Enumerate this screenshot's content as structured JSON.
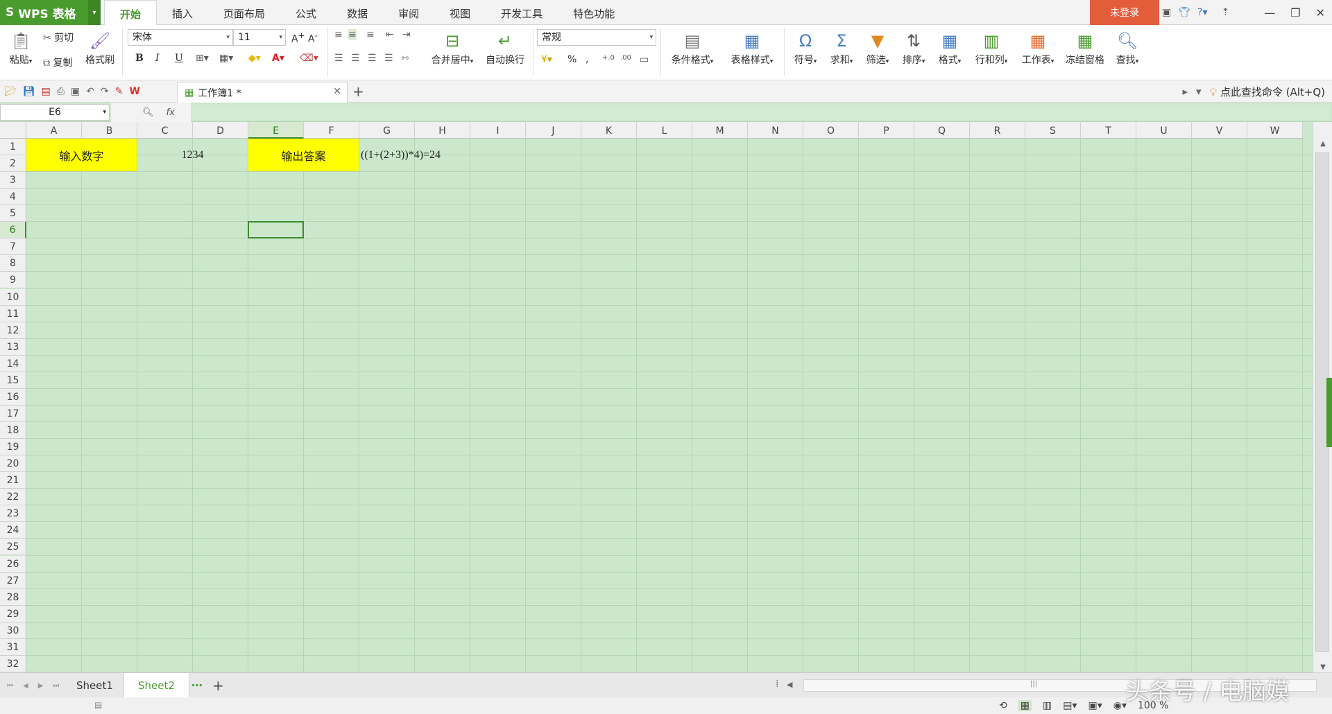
{
  "app": {
    "name": "WPS 表格",
    "logo_icon": "wps-s-icon"
  },
  "menu": {
    "tabs": [
      "开始",
      "插入",
      "页面布局",
      "公式",
      "数据",
      "审阅",
      "视图",
      "开发工具",
      "特色功能"
    ],
    "active": "开始"
  },
  "account": {
    "login_label": "未登录"
  },
  "ribbon": {
    "paste": "粘贴",
    "cut": "剪切",
    "copy": "复制",
    "format_painter": "格式刷",
    "font_name": "宋体",
    "font_size": "11",
    "bold": "B",
    "italic": "I",
    "underline": "U",
    "merge_center": "合并居中",
    "wrap_text": "自动换行",
    "number_format": "常规",
    "percent": "%",
    "comma": ",",
    "conditional_format": "条件格式",
    "table_style": "表格样式",
    "symbol": "符号",
    "sum": "求和",
    "filter": "筛选",
    "sort": "排序",
    "format": "格式",
    "row_col": "行和列",
    "worksheet": "工作表",
    "freeze": "冻结窗格",
    "find": "查找"
  },
  "quickbar": {
    "doc_tab": "工作簿1 *",
    "search_cmd": "点此查找命令 (Alt+Q)"
  },
  "formula_bar": {
    "name_box": "E6",
    "fx": "fx",
    "value": ""
  },
  "grid": {
    "columns": [
      "A",
      "B",
      "C",
      "D",
      "E",
      "F",
      "G",
      "H",
      "I",
      "J",
      "K",
      "L",
      "M",
      "N",
      "O",
      "P",
      "Q",
      "R",
      "S",
      "T",
      "U",
      "V",
      "W"
    ],
    "selected_column": "E",
    "rows": [
      "1",
      "2",
      "3",
      "4",
      "5",
      "6",
      "7",
      "8",
      "9",
      "10",
      "11",
      "12",
      "13",
      "14",
      "15",
      "16",
      "17",
      "18",
      "19",
      "20",
      "21",
      "22",
      "23",
      "24",
      "25",
      "26",
      "27",
      "28",
      "29",
      "30",
      "31",
      "32"
    ],
    "selected_row": "6",
    "cells": {
      "input_label": "输入数字",
      "input_value": "1234",
      "output_label": "输出答案",
      "output_value": "((1+(2+3))*4)=24"
    },
    "highlight_color": "#ffff00",
    "background_color": "#cce8cc"
  },
  "sheets": {
    "tabs": [
      "Sheet1",
      "Sheet2"
    ],
    "active": "Sheet2",
    "more": "⋯",
    "add": "+"
  },
  "status": {
    "zoom": "100 %"
  },
  "watermark": {
    "text": "头条号 / 电脑嫫"
  }
}
